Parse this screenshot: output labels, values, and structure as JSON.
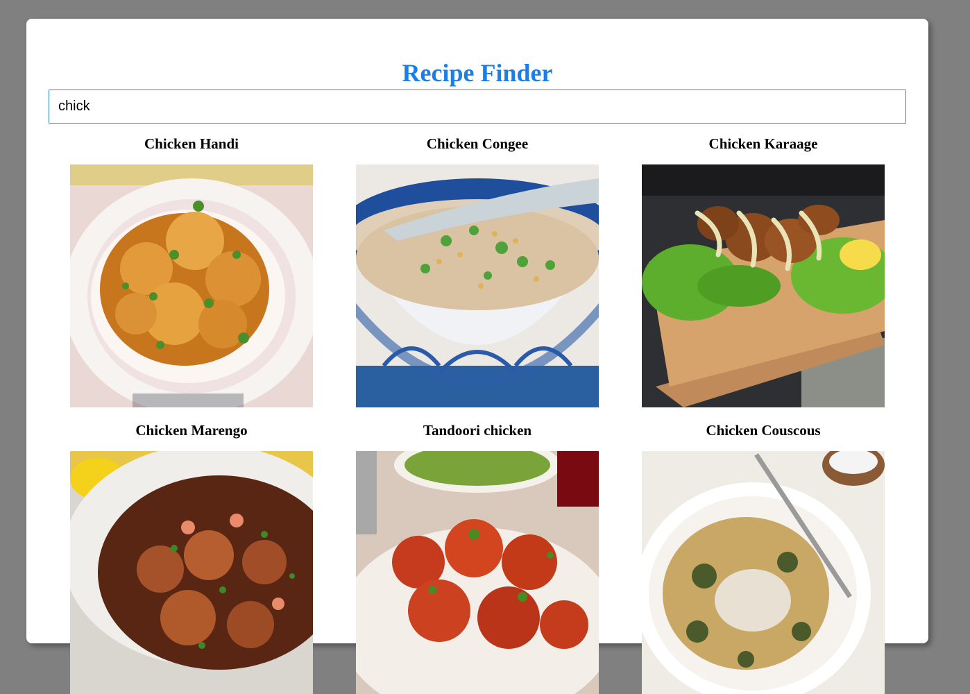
{
  "app": {
    "title": "Recipe Finder"
  },
  "search": {
    "value": "chick"
  },
  "recipes": [
    {
      "name": "Chicken Handi"
    },
    {
      "name": "Chicken Congee"
    },
    {
      "name": "Chicken Karaage"
    },
    {
      "name": "Chicken Marengo"
    },
    {
      "name": "Tandoori chicken"
    },
    {
      "name": "Chicken Couscous"
    }
  ],
  "colors": {
    "accent": "#1a7fe8",
    "page_bg": "#808080",
    "card_bg": "#ffffff",
    "search_border": "#2a8fb0"
  }
}
